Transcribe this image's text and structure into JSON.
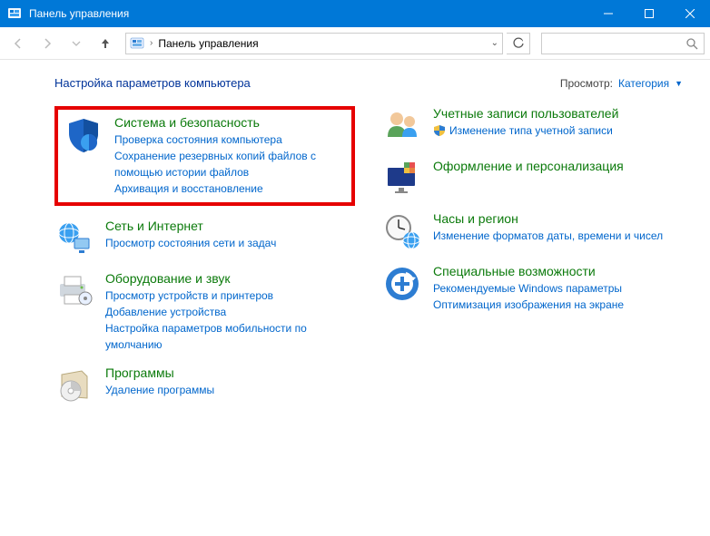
{
  "window": {
    "title": "Панель управления"
  },
  "breadcrumb": {
    "text": "Панель управления"
  },
  "page": {
    "heading": "Настройка параметров компьютера"
  },
  "viewby": {
    "label": "Просмотр:",
    "value": "Категория"
  },
  "cats": {
    "system": {
      "title": "Система и безопасность",
      "l1": "Проверка состояния компьютера",
      "l2": "Сохранение резервных копий файлов с помощью истории файлов",
      "l3": "Архивация и восстановление"
    },
    "network": {
      "title": "Сеть и Интернет",
      "l1": "Просмотр состояния сети и задач"
    },
    "hardware": {
      "title": "Оборудование и звук",
      "l1": "Просмотр устройств и принтеров",
      "l2": "Добавление устройства",
      "l3": "Настройка параметров мобильности по умолчанию"
    },
    "programs": {
      "title": "Программы",
      "l1": "Удаление программы"
    },
    "accounts": {
      "title": "Учетные записи пользователей",
      "l1": "Изменение типа учетной записи"
    },
    "appearance": {
      "title": "Оформление и персонализация"
    },
    "clock": {
      "title": "Часы и регион",
      "l1": "Изменение форматов даты, времени и чисел"
    },
    "ease": {
      "title": "Специальные возможности",
      "l1": "Рекомендуемые Windows параметры",
      "l2": "Оптимизация изображения на экране"
    }
  }
}
